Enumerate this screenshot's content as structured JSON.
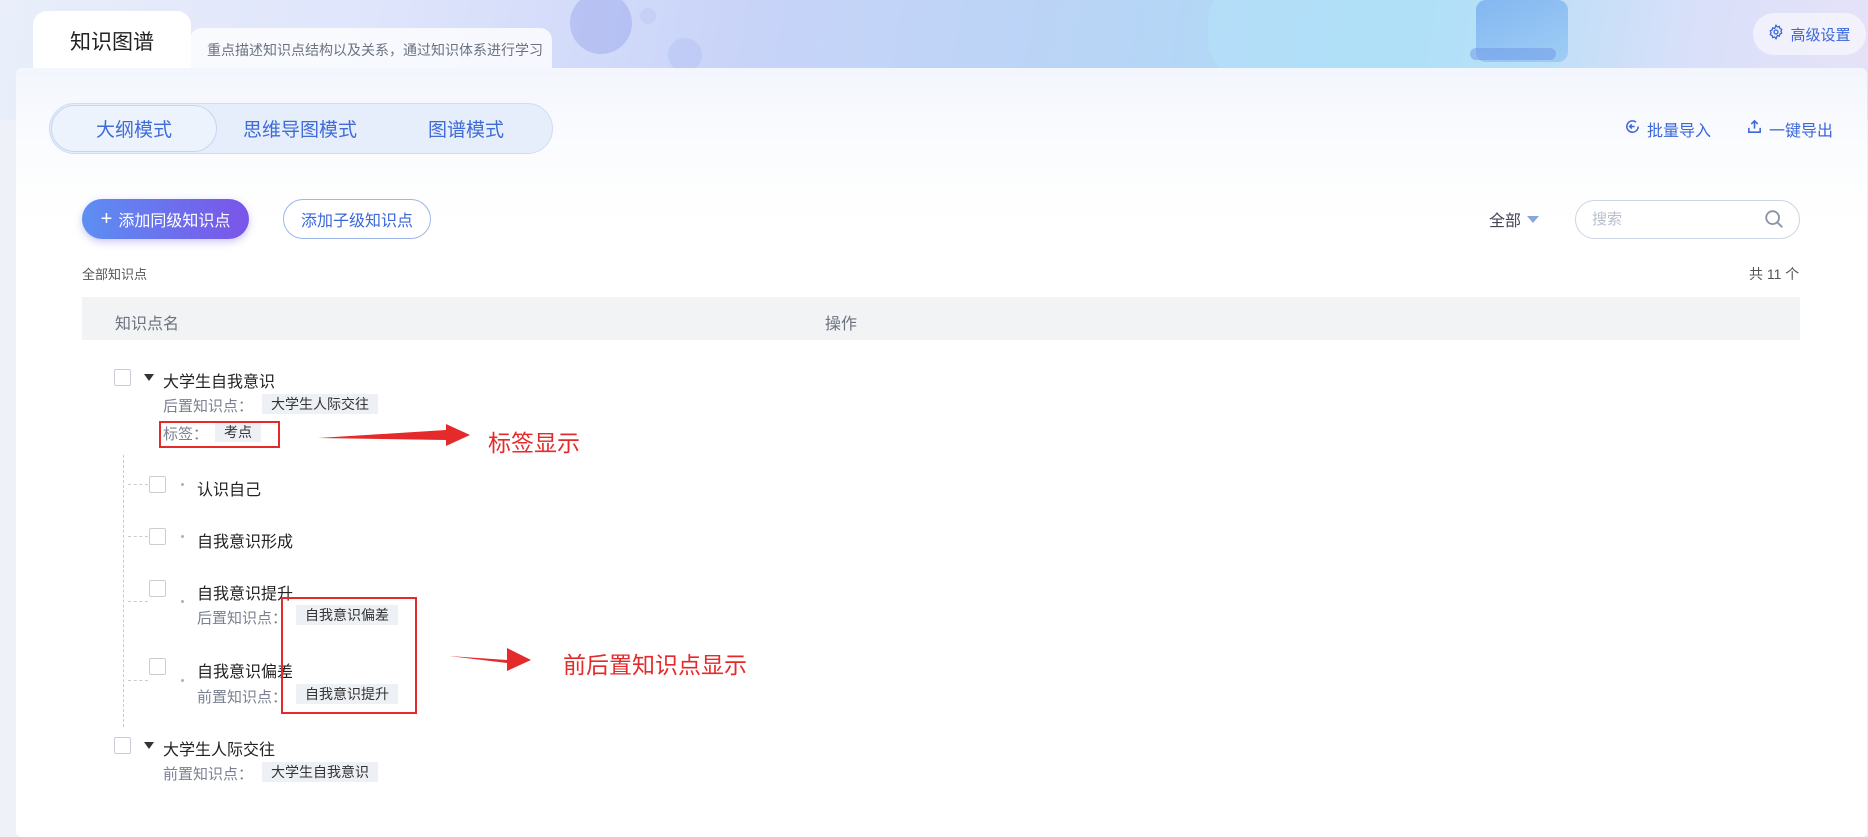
{
  "header": {
    "active_tab": "知识图谱",
    "tab_description": "重点描述知识点结构以及关系，通过知识体系进行学习",
    "advanced_settings": "高级设置"
  },
  "modes": [
    {
      "label": "大纲模式",
      "active": true
    },
    {
      "label": "思维导图模式",
      "active": false
    },
    {
      "label": "图谱模式",
      "active": false
    }
  ],
  "top_actions": {
    "batch_import": "批量导入",
    "export": "一键导出"
  },
  "toolbar": {
    "add_sibling": "添加同级知识点",
    "add_child": "添加子级知识点",
    "filter_value": "全部",
    "search_placeholder": "搜索"
  },
  "summary": {
    "left": "全部知识点",
    "right": "共 11 个"
  },
  "table": {
    "columns": [
      "知识点名",
      "操作"
    ]
  },
  "labels": {
    "post_prereq": "后置知识点：",
    "pre_prereq": "前置知识点：",
    "tag": "标签："
  },
  "tree": {
    "root1": {
      "name": "大学生自我意识",
      "post": "大学生人际交往",
      "tag": "考点",
      "children": [
        {
          "name": "认识自己"
        },
        {
          "name": "自我意识形成"
        },
        {
          "name": "自我意识提升",
          "post": "自我意识偏差"
        },
        {
          "name": "自我意识偏差",
          "pre": "自我意识提升"
        }
      ]
    },
    "root2": {
      "name": "大学生人际交往",
      "pre": "大学生自我意识"
    }
  },
  "annotations": {
    "tag_display": "标签显示",
    "prereq_display": "前后置知识点显示"
  },
  "colors": {
    "accent": "#3b67d8",
    "primary_gradient_start": "#5c8ff2",
    "primary_gradient_end": "#7b54e9",
    "annotation_red": "#e42a2a"
  }
}
